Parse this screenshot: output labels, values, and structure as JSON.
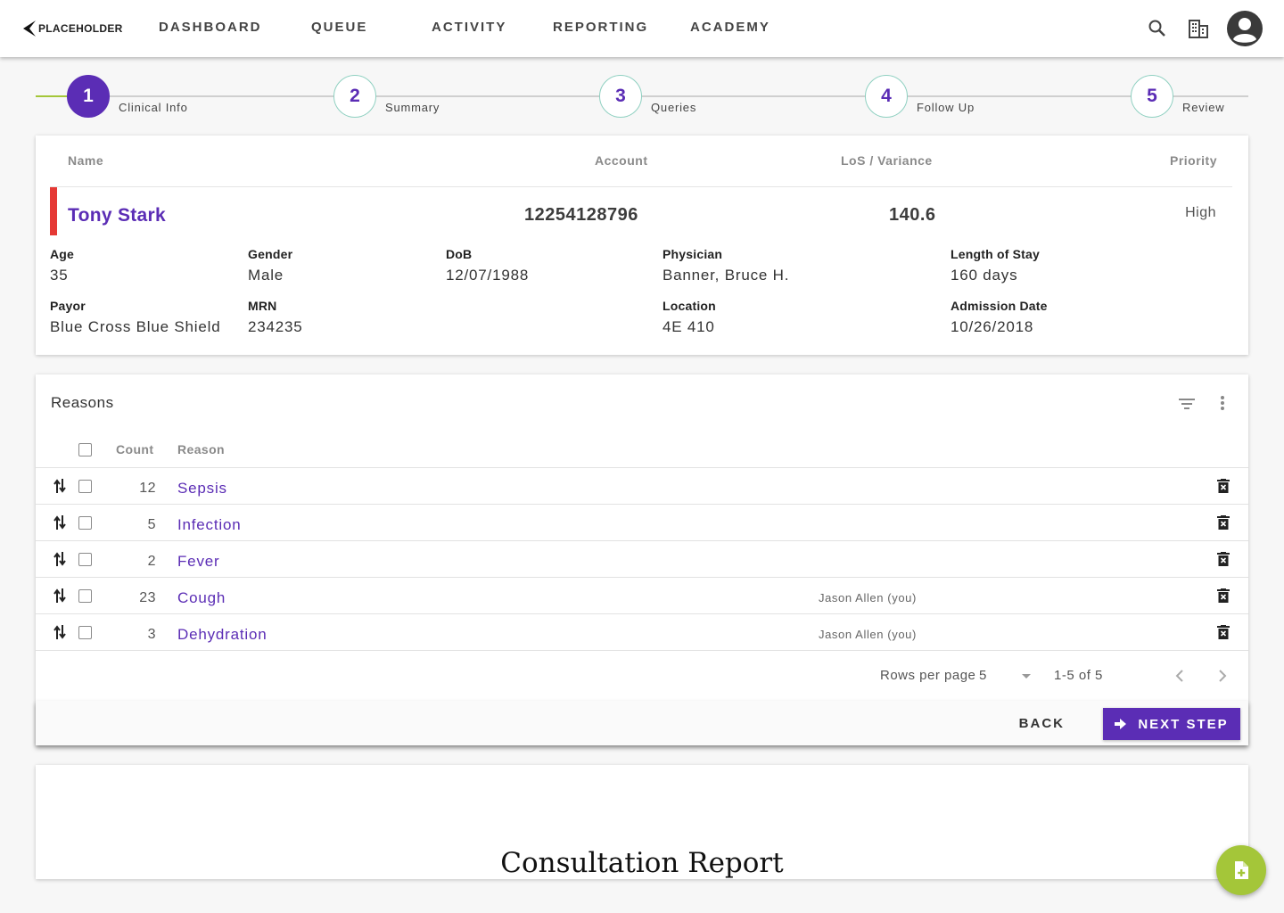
{
  "app": {
    "logo_text": "PLACEHOLDER"
  },
  "nav": {
    "items": [
      {
        "label": "DASHBOARD"
      },
      {
        "label": "QUEUE"
      },
      {
        "label": "ACTIVITY"
      },
      {
        "label": "REPORTING"
      },
      {
        "label": "ACADEMY"
      }
    ],
    "icons": [
      "search-icon",
      "building-icon",
      "account-icon"
    ]
  },
  "stepper": {
    "active_step": 1,
    "steps": [
      {
        "number": "1",
        "label": "Clinical Info"
      },
      {
        "number": "2",
        "label": "Summary"
      },
      {
        "number": "3",
        "label": "Queries"
      },
      {
        "number": "4",
        "label": "Follow Up"
      },
      {
        "number": "5",
        "label": "Review"
      }
    ]
  },
  "patient": {
    "headers": {
      "name": "Name",
      "account": "Account",
      "los": "LoS / Variance",
      "priority": "Priority"
    },
    "name": "Tony Stark",
    "account": "12254128796",
    "los_variance": "140.6",
    "priority": "High",
    "priority_color": "#e53935",
    "fields": {
      "age": {
        "label": "Age",
        "value": "35"
      },
      "gender": {
        "label": "Gender",
        "value": "Male"
      },
      "dob": {
        "label": "DoB",
        "value": "12/07/1988"
      },
      "physician": {
        "label": "Physician",
        "value": "Banner, Bruce H."
      },
      "length_of_stay": {
        "label": "Length of Stay",
        "value": "160 days"
      },
      "payor": {
        "label": "Payor",
        "value": "Blue Cross Blue Shield"
      },
      "mrn": {
        "label": "MRN",
        "value": "234235"
      },
      "location": {
        "label": "Location",
        "value": "4E 410"
      },
      "admission_date": {
        "label": "Admission Date",
        "value": "10/26/2018"
      }
    }
  },
  "reasons": {
    "title": "Reasons",
    "columns": {
      "count": "Count",
      "reason": "Reason"
    },
    "rows": [
      {
        "count": "12",
        "reason": "Sepsis",
        "user": ""
      },
      {
        "count": "5",
        "reason": "Infection",
        "user": ""
      },
      {
        "count": "2",
        "reason": "Fever",
        "user": ""
      },
      {
        "count": "23",
        "reason": "Cough",
        "user": "Jason Allen (you)"
      },
      {
        "count": "3",
        "reason": "Dehydration",
        "user": "Jason Allen (you)"
      }
    ],
    "pagination": {
      "rows_per_page_label": "Rows per page",
      "rows_per_page_value": "5",
      "range": "1-5 of 5"
    }
  },
  "actions": {
    "back": "BACK",
    "next": "NEXT STEP"
  },
  "document": {
    "title": "Consultation Report"
  },
  "colors": {
    "primary": "#5b2db5",
    "accent": "#a4c639",
    "step_border": "#8fd0c1"
  }
}
